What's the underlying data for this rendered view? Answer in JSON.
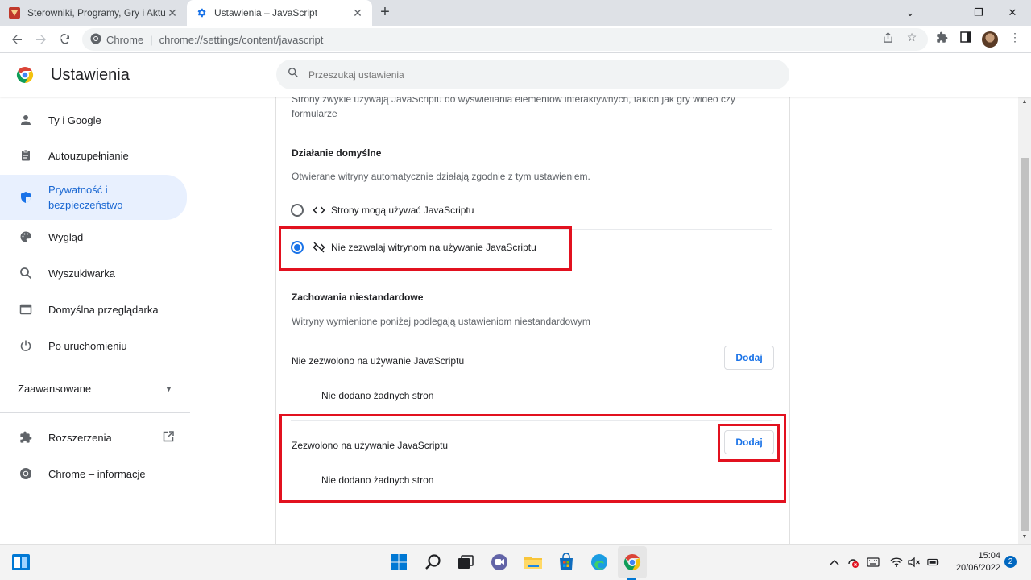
{
  "browser": {
    "tabs": [
      {
        "title": "Sterowniki, Programy, Gry i Aktua",
        "icon": "site-favicon-icon"
      },
      {
        "title": "Ustawienia – JavaScript",
        "icon": "gear-icon"
      }
    ],
    "new_tab_label": "+",
    "window_controls": {
      "minimize": "—",
      "restore": "❐",
      "close": "✕",
      "tab_search": "⌄"
    },
    "address": {
      "site_label": "Chrome",
      "separator": "|",
      "url": "chrome://settings/content/javascript"
    }
  },
  "settings": {
    "title": "Ustawienia",
    "search_placeholder": "Przeszukaj ustawienia",
    "sidebar": {
      "items": [
        {
          "label": "Ty i Google",
          "icon": "person-icon"
        },
        {
          "label": "Autouzupełnianie",
          "icon": "clipboard-icon"
        },
        {
          "label": "Prywatność i bezpieczeństwo",
          "icon": "shield-icon",
          "active": true
        },
        {
          "label": "Wygląd",
          "icon": "palette-icon"
        },
        {
          "label": "Wyszukiwarka",
          "icon": "search-icon"
        },
        {
          "label": "Domyślna przeglądarka",
          "icon": "browser-window-icon"
        },
        {
          "label": "Po uruchomieniu",
          "icon": "power-icon"
        }
      ],
      "advanced": "Zaawansowane",
      "extensions": "Rozszerzenia",
      "about": "Chrome – informacje"
    },
    "content": {
      "intro": "Strony zwykle używają JavaScriptu do wyświetlania elementów interaktywnych, takich jak gry wideo czy formularze",
      "default_heading": "Działanie domyślne",
      "default_desc": "Otwierane witryny automatycznie działają zgodnie z tym ustawieniem.",
      "options": [
        {
          "label": "Strony mogą używać JavaScriptu",
          "icon": "code-icon",
          "checked": false
        },
        {
          "label": "Nie zezwalaj witrynom na używanie JavaScriptu",
          "icon": "code-off-icon",
          "checked": true
        }
      ],
      "custom_heading": "Zachowania niestandardowe",
      "custom_desc": "Witryny wymienione poniżej podlegają ustawieniom niestandardowym",
      "blocked": {
        "label": "Nie zezwolono na używanie JavaScriptu",
        "button": "Dodaj",
        "empty": "Nie dodano żadnych stron"
      },
      "allowed": {
        "label": "Zezwolono na używanie JavaScriptu",
        "button": "Dodaj",
        "empty": "Nie dodano żadnych stron"
      }
    }
  },
  "taskbar": {
    "time": "15:04",
    "date": "20/06/2022",
    "notifications": "2"
  },
  "colors": {
    "accent": "#1a73e8",
    "highlight_box": "#e2111f",
    "active_nav_bg": "#e8f0fe"
  }
}
